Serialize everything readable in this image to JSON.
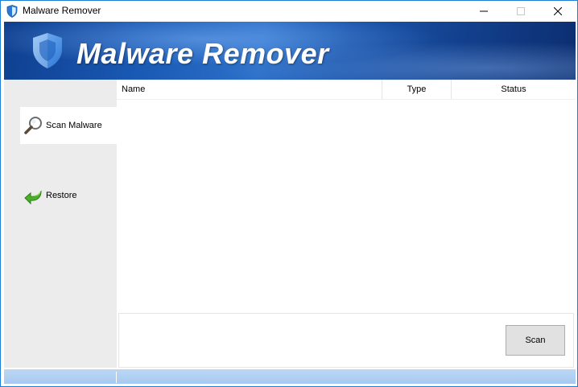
{
  "window": {
    "title": "Malware Remover"
  },
  "banner": {
    "title": "Malware Remover",
    "icon": "shield-icon"
  },
  "sidebar": {
    "items": [
      {
        "label": "Scan Malware",
        "icon": "magnifier-icon",
        "active": true
      },
      {
        "label": "Restore",
        "icon": "restore-arrow-icon",
        "active": false
      }
    ]
  },
  "list": {
    "columns": [
      "Name",
      "Type",
      "Status"
    ],
    "rows": []
  },
  "actions": {
    "scan_label": "Scan"
  },
  "colors": {
    "banner": "#1a5ab5",
    "sidebar": "#ececec",
    "statusbar": "#a7c9f0",
    "window_border": "#1e7fd6"
  }
}
